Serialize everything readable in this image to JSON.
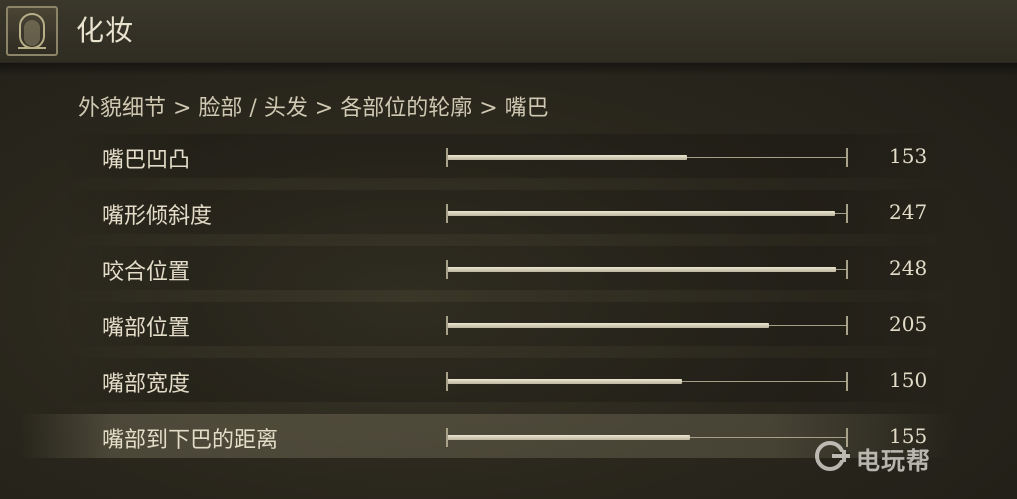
{
  "header": {
    "title": "化妆",
    "icon": "mirror-icon"
  },
  "breadcrumb": "外貌细节 > 脸部 / 头发 > 各部位的轮廓 > 嘴巴",
  "slider_max": 255,
  "rows": [
    {
      "label": "嘴巴凹凸",
      "value": "153",
      "fill": 0.6
    },
    {
      "label": "嘴形倾斜度",
      "value": "247",
      "fill": 0.969
    },
    {
      "label": "咬合位置",
      "value": "248",
      "fill": 0.973
    },
    {
      "label": "嘴部位置",
      "value": "205",
      "fill": 0.804
    },
    {
      "label": "嘴部宽度",
      "value": "150",
      "fill": 0.588
    },
    {
      "label": "嘴部到下巴的距离",
      "value": "155",
      "fill": 0.608,
      "selected": true
    }
  ],
  "watermark": {
    "text": "电玩帮",
    "icon": "gamepad-logo-icon"
  }
}
